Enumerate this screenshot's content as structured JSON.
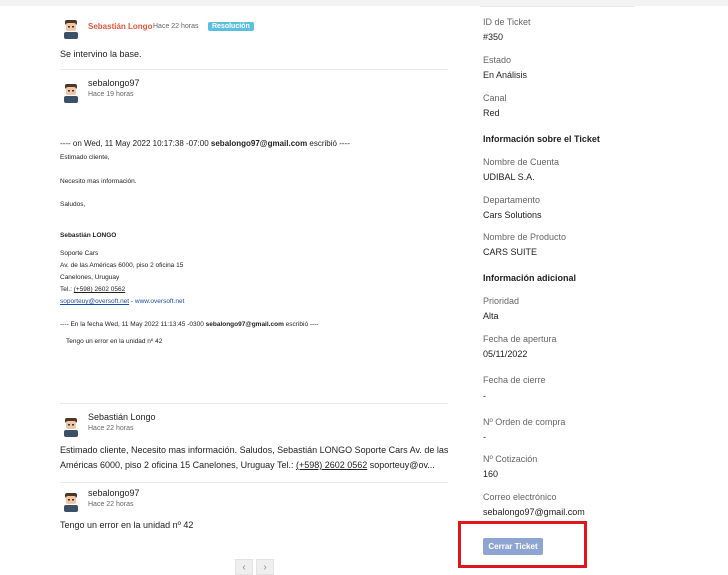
{
  "colors": {
    "accent_name": "#e8543e",
    "badge": "#5bc0de",
    "button": "#8ea4d2",
    "highlight": "#e0161c",
    "link": "#1a4fa8"
  },
  "thread": {
    "first": {
      "author": "Sebastián Longo",
      "time": "Hace 22 horas",
      "badge": "Resolución",
      "text": "Se intervino la base."
    },
    "reply1": {
      "author": "sebalongo97",
      "time": "Hace 19 horas",
      "email_header_prefix": "---- on Wed, 11 May 2022 10:17:38 -07:00 ",
      "email_header_email": "sebalongo97@gmail.com",
      "email_header_suffix": "  escribió ----",
      "greeting": "Estimado cliente,",
      "request": "Necesito mas información.",
      "closing": "Saludos,",
      "sig_name": "Sebastián LONGO",
      "sig_company": "Soporte Cars",
      "sig_address1": "Av. de las Américas 6000, piso 2 oficina 15",
      "sig_address2": "Canelones, Uruguay",
      "sig_tel_label": "Tel.: ",
      "sig_tel": "(+598) 2602 0562",
      "sig_email": "soporteuy@oversoft.net",
      "sig_sep": " - ",
      "sig_web": "www.oversoft.net",
      "quote_header_prefix": "---- En la fecha  Wed, 11 May 2022 11:13:45 -0300 ",
      "quote_header_email": "sebalongo97@gmail.com",
      "quote_header_suffix": "  escribió ----",
      "quote_text": "Tengo un error en la unidad nº 42"
    },
    "reply2": {
      "author": "Sebastián Longo",
      "time": "Hace 22 horas",
      "line1": "Estimado cliente, Necesito mas información. Saludos, Sebastián LONGO Soporte Cars Av. de las",
      "line2_prefix": "Américas 6000, piso 2 oficina 15 Canelones, Uruguay Tel.: ",
      "line2_tel": "(+598) 2602 0562",
      "line2_suffix": " soporteuy@ov..."
    },
    "reply3": {
      "author": "sebalongo97",
      "time": "Hace 22 horas",
      "text": "Tengo un error en la unidad nº 42"
    }
  },
  "pagination": {
    "prev_icon": "chevron-left-icon",
    "next_icon": "chevron-right-icon",
    "prev": "‹",
    "next": "›"
  },
  "sidebar": {
    "ticket_id_label": "ID de Ticket",
    "ticket_id": "#350",
    "status_label": "Estado",
    "status": "En Análisis",
    "channel_label": "Canal",
    "channel": "Red",
    "ticket_info_heading": "Información sobre el Ticket",
    "account_label": "Nombre de Cuenta",
    "account": "UDIBAL S.A.",
    "department_label": "Departamento",
    "department": "Cars Solutions",
    "product_label": "Nombre de Producto",
    "product": "CARS SUITE",
    "extra_heading": "Información adicional",
    "priority_label": "Prioridad",
    "priority": "Alta",
    "opened_label": "Fecha de apertura",
    "opened": "05/11/2022",
    "closed_label": "Fecha de cierre",
    "closed": "-",
    "po_label": "Nº Orden de compra",
    "po": "-",
    "quote_label": "Nº Cotización",
    "quote": "160",
    "email_label": "Correo electrónico",
    "email": "sebalongo97@gmail.com",
    "close_button": "Cerrar Ticket"
  }
}
